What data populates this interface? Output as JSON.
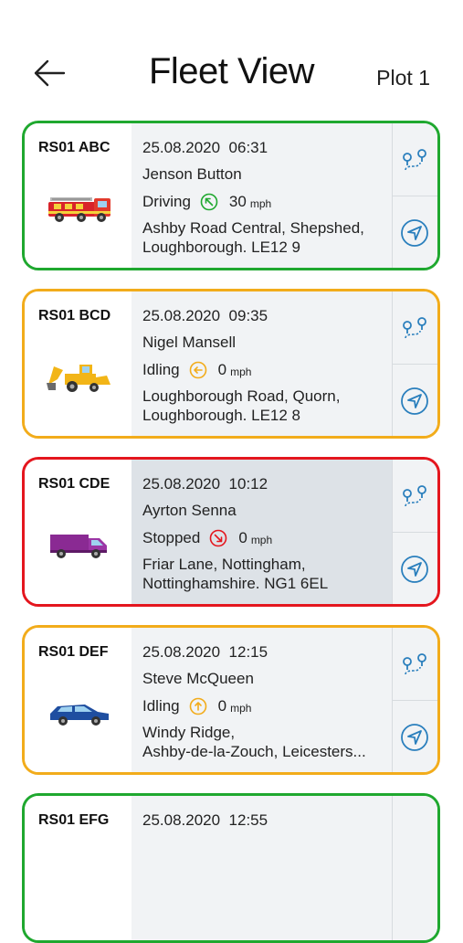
{
  "header": {
    "title": "Fleet View",
    "plot_label": "Plot 1"
  },
  "colors": {
    "driving": "#1fa82f",
    "idling": "#f2ac1b",
    "stopped": "#e4161e",
    "accent": "#2a7fbd"
  },
  "vehicles": [
    {
      "reg": "RS01 ABC",
      "date": "25.08.2020",
      "time": "06:31",
      "driver": "Jenson Button",
      "status": "Driving",
      "status_icon": "arrow-up-left-circle-icon",
      "speed": "30",
      "unit": "mph",
      "address1": "Ashby Road Central, Shepshed,",
      "address2": "Loughborough. LE12 9",
      "vehicle_icon": "fire-engine-icon"
    },
    {
      "reg": "RS01 BCD",
      "date": "25.08.2020",
      "time": "09:35",
      "driver": "Nigel Mansell",
      "status": "Idling",
      "status_icon": "arrow-left-circle-icon",
      "speed": "0",
      "unit": "mph",
      "address1": "Loughborough Road, Quorn,",
      "address2": "Loughborough. LE12 8",
      "vehicle_icon": "digger-icon"
    },
    {
      "reg": "RS01 CDE",
      "date": "25.08.2020",
      "time": "10:12",
      "driver": "Ayrton Senna",
      "status": "Stopped",
      "status_icon": "arrow-down-right-circle-icon",
      "speed": "0",
      "unit": "mph",
      "address1": "Friar Lane, Nottingham,",
      "address2": "Nottinghamshire. NG1 6EL",
      "vehicle_icon": "van-icon"
    },
    {
      "reg": "RS01 DEF",
      "date": "25.08.2020",
      "time": "12:15",
      "driver": "Steve McQueen",
      "status": "Idling",
      "status_icon": "arrow-up-circle-icon",
      "speed": "0",
      "unit": "mph",
      "address1": "Windy Ridge,",
      "address2": "Ashby-de-la-Zouch, Leicesters...",
      "vehicle_icon": "car-icon"
    },
    {
      "reg": "RS01 EFG",
      "date": "25.08.2020",
      "time": "12:55"
    }
  ]
}
